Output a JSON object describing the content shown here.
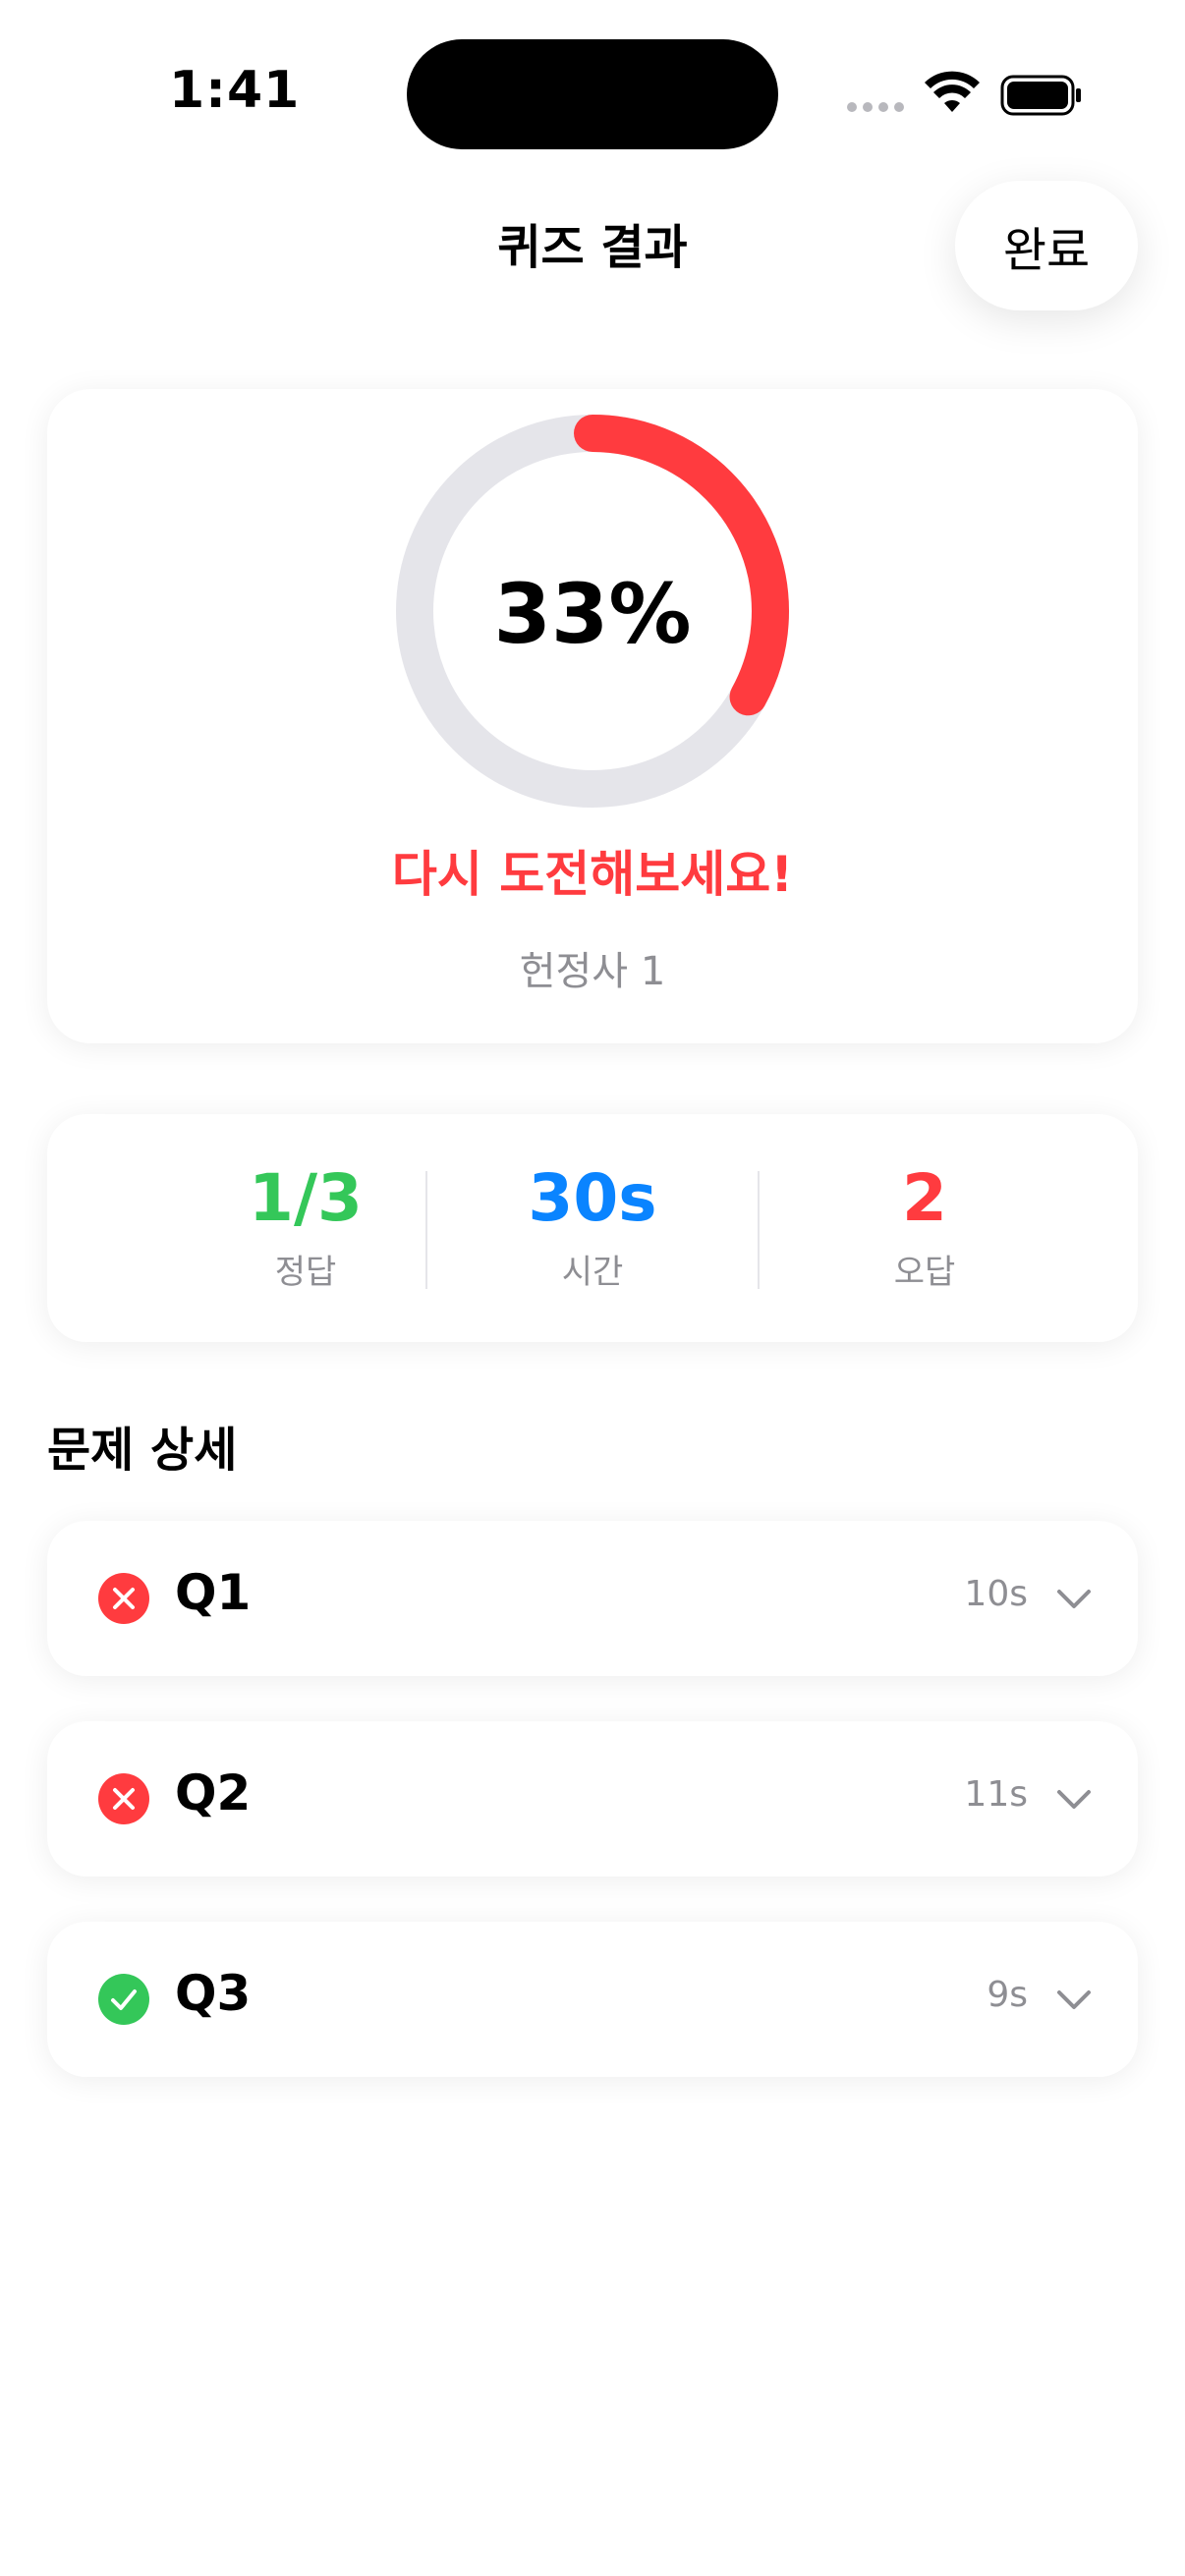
{
  "status_bar": {
    "time": "1:41"
  },
  "nav": {
    "title": "퀴즈 결과",
    "done_label": "완료"
  },
  "score": {
    "percent_text": "33%",
    "progress": 0.33,
    "message": "다시 도전해보세요!",
    "quiz_name": "헌정사 1"
  },
  "stats": {
    "correct": {
      "value": "1/3",
      "label": "정답"
    },
    "time": {
      "value": "30s",
      "label": "시간"
    },
    "wrong": {
      "value": "2",
      "label": "오답"
    }
  },
  "section": {
    "title": "문제 상세"
  },
  "questions": [
    {
      "label": "Q1",
      "time": "10s",
      "correct": false
    },
    {
      "label": "Q2",
      "time": "11s",
      "correct": false
    },
    {
      "label": "Q3",
      "time": "9s",
      "correct": true
    }
  ],
  "colors": {
    "accent_red": "#ff3b3f",
    "accent_green": "#34c759",
    "accent_blue": "#0a84ff",
    "ring_track": "#e5e5ea",
    "secondary_text": "#8e8e93"
  }
}
